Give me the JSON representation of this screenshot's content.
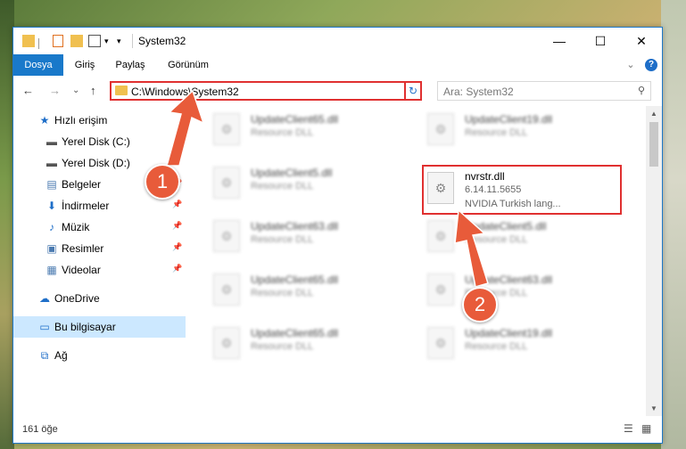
{
  "window": {
    "title": "System32",
    "minimize": "—",
    "maximize": "☐",
    "close": "✕"
  },
  "ribbon": {
    "tabs": [
      {
        "label": "Dosya",
        "active": true
      },
      {
        "label": "Giriş",
        "active": false
      },
      {
        "label": "Paylaş",
        "active": false
      },
      {
        "label": "Görünüm",
        "active": false
      }
    ],
    "expand": "⌄",
    "help": "?"
  },
  "nav": {
    "back": "←",
    "forward": "→",
    "recent": "⌄",
    "up": "↑",
    "address_path": "C:\\Windows\\System32",
    "address_dropdown": "⌄",
    "refresh": "↻",
    "search_placeholder": "Ara: System32",
    "search_icon": "⚲"
  },
  "sidebar": {
    "items": [
      {
        "label": "Hızlı erişim",
        "icon": "★",
        "pinned": false
      },
      {
        "label": "Yerel Disk (C:)",
        "icon": "▬",
        "pinned": false
      },
      {
        "label": "Yerel Disk (D:)",
        "icon": "▬",
        "pinned": true
      },
      {
        "label": "Belgeler",
        "icon": "▤",
        "pinned": true
      },
      {
        "label": "İndirmeler",
        "icon": "⬇",
        "pinned": true
      },
      {
        "label": "Müzik",
        "icon": "♪",
        "pinned": true
      },
      {
        "label": "Resimler",
        "icon": "▣",
        "pinned": true
      },
      {
        "label": "Videolar",
        "icon": "▦",
        "pinned": true
      },
      {
        "label": "OneDrive",
        "icon": "☁",
        "pinned": false
      },
      {
        "label": "Bu bilgisayar",
        "icon": "▭",
        "pinned": false,
        "selected": true
      },
      {
        "label": "Ağ",
        "icon": "⧉",
        "pinned": false
      }
    ],
    "pin_glyph": "📌"
  },
  "files": {
    "left": [
      {
        "name": "UpdateClient65.dll",
        "type": "Resource DLL"
      },
      {
        "name": "UpdateClient5.dll",
        "type": "Resource DLL"
      },
      {
        "name": "UpdateClient63.dll",
        "type": "Resource DLL"
      },
      {
        "name": "UpdateClient65.dll",
        "type": "Resource DLL"
      },
      {
        "name": "UpdateClient65.dll",
        "type": "Resource DLL"
      }
    ],
    "right": [
      {
        "name": "UpdateClient19.dll",
        "type": "Resource DLL"
      },
      {
        "name": "UpdateClient5.dll",
        "type": "Resource DLL"
      },
      {
        "name": "UpdateClient63.dll",
        "type": "Resource DLL"
      },
      {
        "name": "UpdateClient19.dll",
        "type": "Resource DLL"
      }
    ],
    "highlighted": {
      "name": "nvrstr.dll",
      "version": "6.14.11.5655",
      "description": "NVIDIA Turkish lang..."
    }
  },
  "status": {
    "count": "161 öğe",
    "view_details": "☰",
    "view_icons": "▦"
  },
  "annotations": {
    "badge1": "1",
    "badge2": "2",
    "arrow_color": "#e85b3a",
    "highlight_color": "#e03030"
  }
}
